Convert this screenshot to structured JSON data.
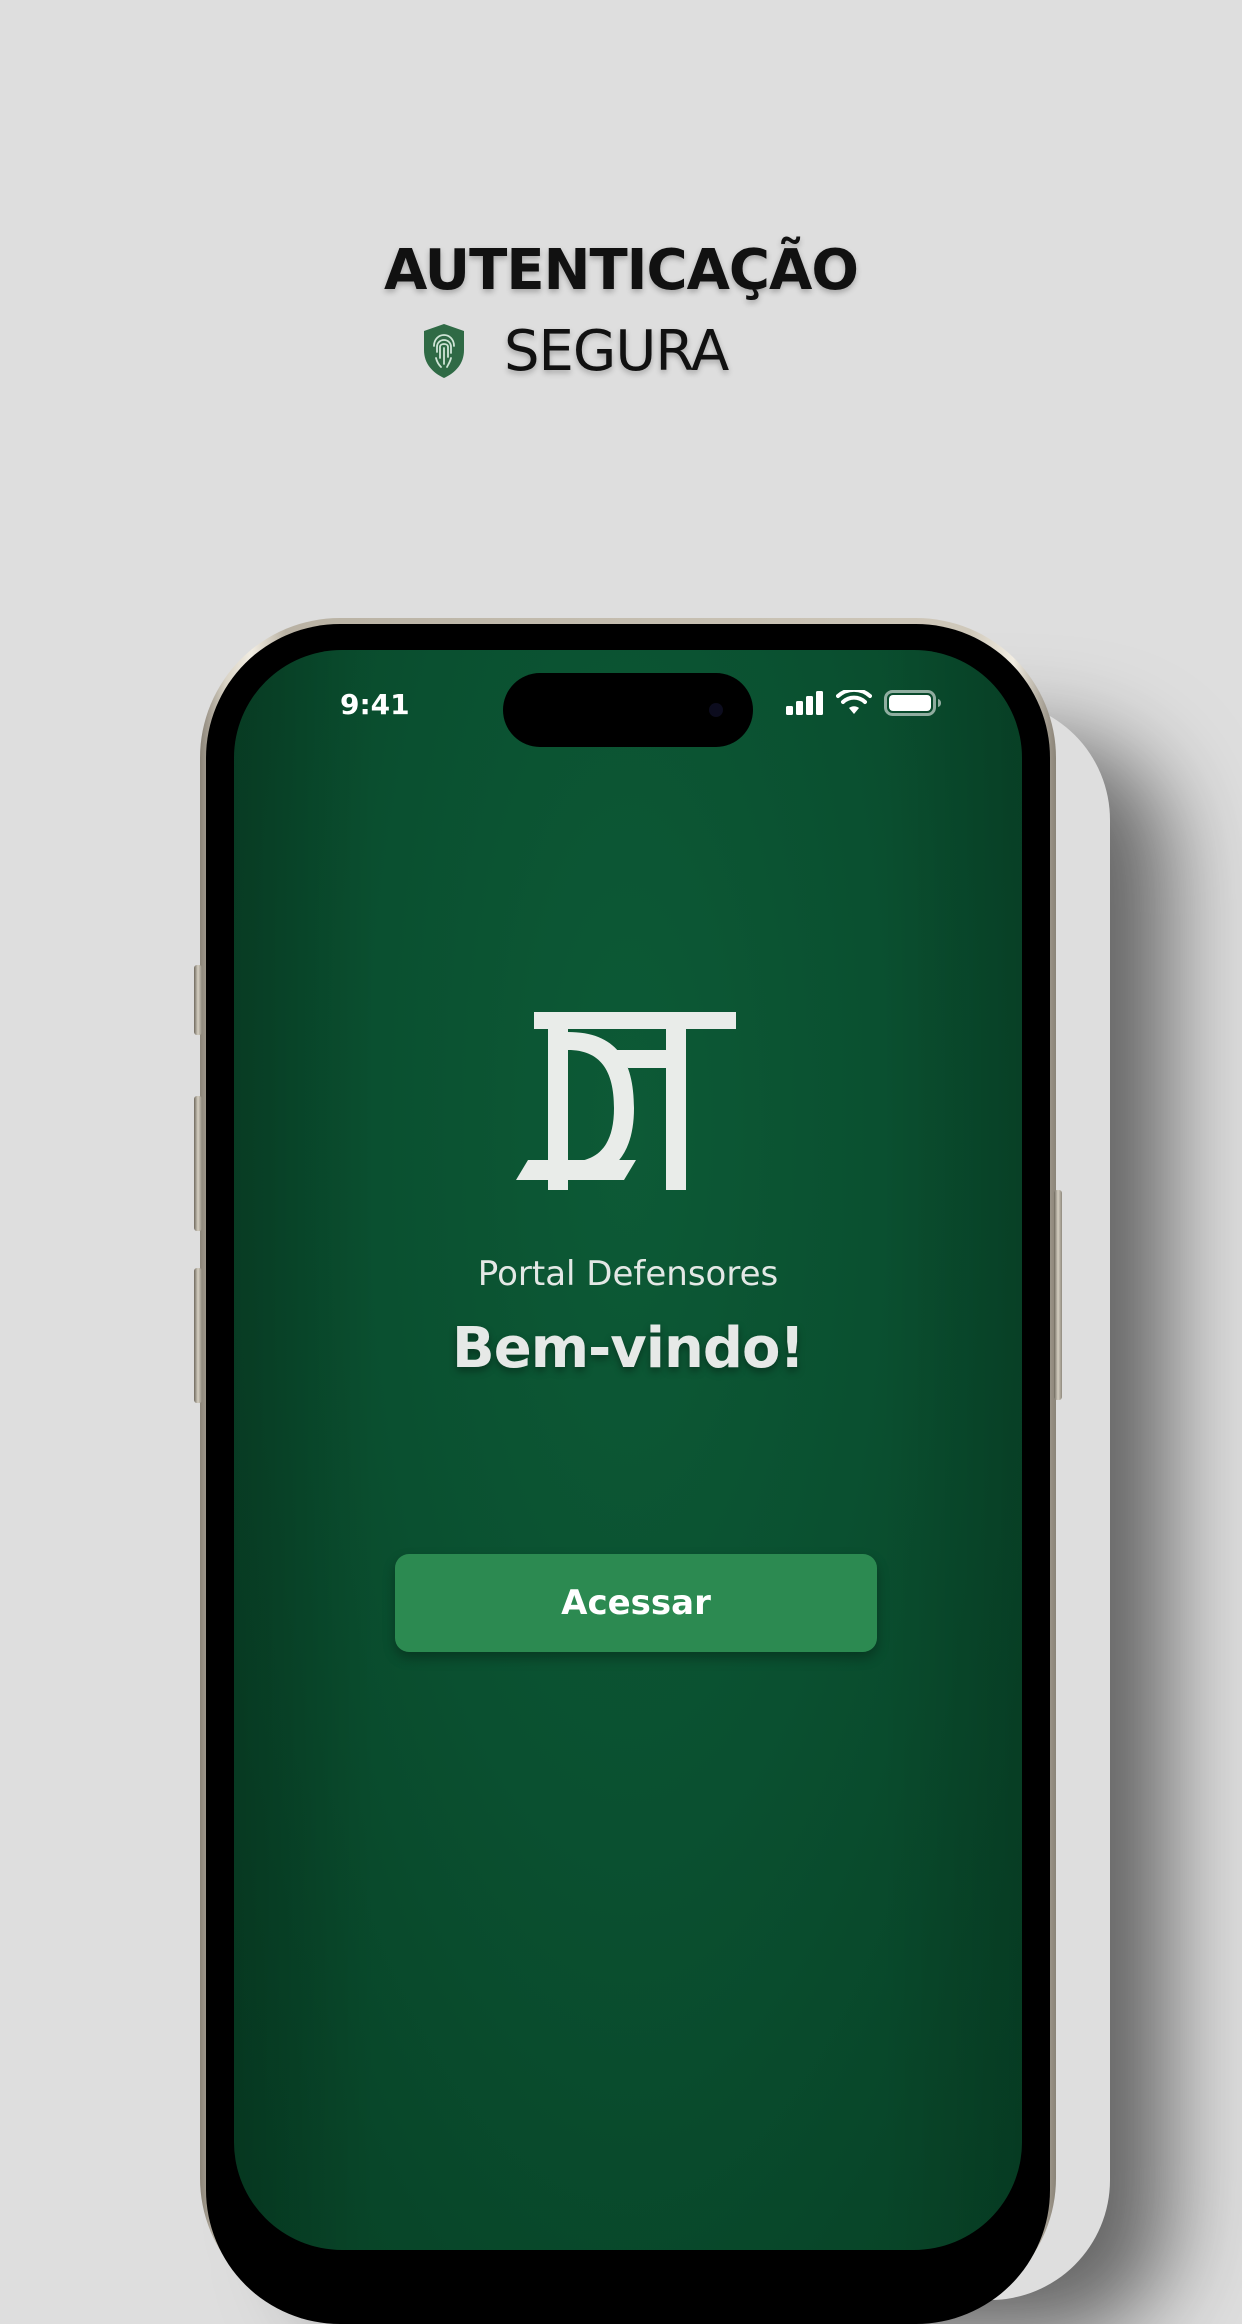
{
  "headline": {
    "line1": "AUTENTICAÇÃO",
    "line2": "SEGURA",
    "icon": "fingerprint-shield-icon"
  },
  "status_bar": {
    "time": "9:41",
    "icons": [
      "cellular-signal-icon",
      "wifi-icon",
      "battery-icon"
    ]
  },
  "app": {
    "logo": "dpt-logo",
    "name": "Portal Defensores",
    "welcome": "Bem-vindo!",
    "access_button_label": "Acessar"
  },
  "colors": {
    "background": "#dedede",
    "screen_green": "#0a5030",
    "button_green": "#2c8a51",
    "shield_green": "#2f6a45"
  }
}
